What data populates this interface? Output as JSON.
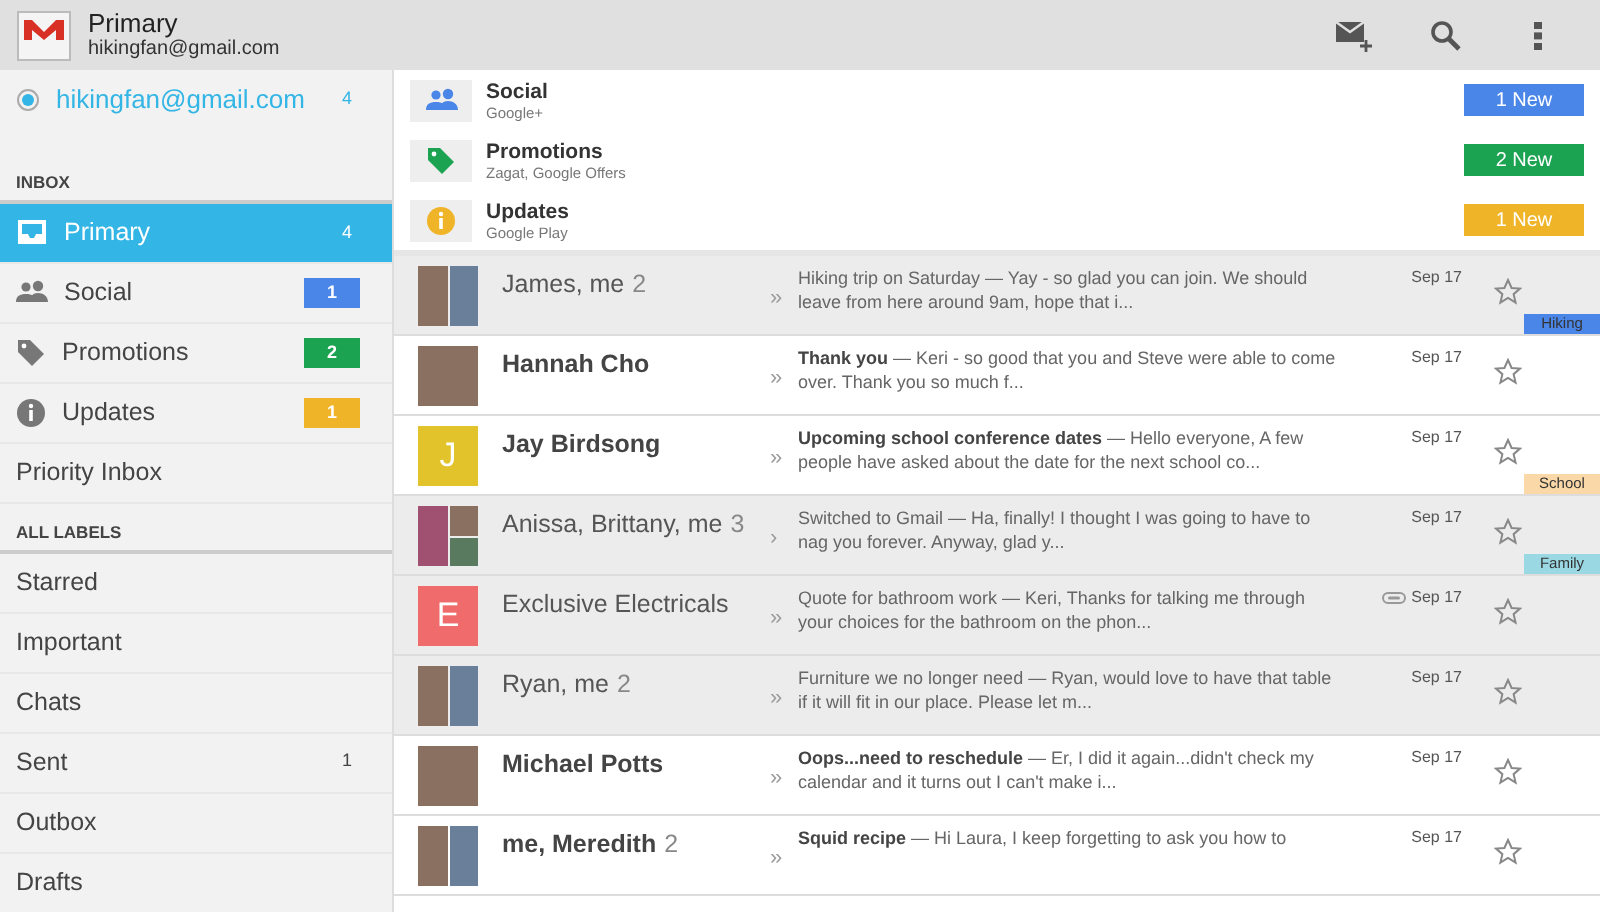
{
  "header": {
    "title": "Primary",
    "account": "hikingfan@gmail.com"
  },
  "sidebar": {
    "items": [
      {
        "kind": "account",
        "label": "hikingfan@gmail.com",
        "count": "4",
        "selected": true
      },
      {
        "kind": "header",
        "label": "INBOX"
      },
      {
        "kind": "inbox",
        "label": "Primary",
        "count": "4",
        "selected": true
      },
      {
        "kind": "people",
        "label": "Social",
        "count": "1",
        "color": "#4a86e8",
        "selected": false
      },
      {
        "kind": "tag",
        "label": "Promotions",
        "count": "2",
        "color": "#1ca352",
        "selected": false
      },
      {
        "kind": "info",
        "label": "Updates",
        "count": "1",
        "color": "#f0b429",
        "selected": false
      },
      {
        "kind": "item",
        "label": "Priority Inbox",
        "selected": false
      },
      {
        "kind": "header",
        "label": "ALL LABELS"
      },
      {
        "kind": "item",
        "label": "Starred",
        "selected": false
      },
      {
        "kind": "item",
        "label": "Important",
        "selected": false
      },
      {
        "kind": "item",
        "label": "Chats",
        "selected": false
      },
      {
        "kind": "item",
        "label": "Sent",
        "count": "1",
        "selected": false
      },
      {
        "kind": "item",
        "label": "Outbox",
        "selected": false
      },
      {
        "kind": "item",
        "label": "Drafts",
        "selected": false
      }
    ]
  },
  "categories": [
    {
      "kind": "people",
      "title": "Social",
      "subtitle": "Google+",
      "badge": "1 New",
      "color": "#4a86e8"
    },
    {
      "kind": "tag",
      "title": "Promotions",
      "subtitle": "Zagat, Google Offers",
      "badge": "2 New",
      "color": "#1ca352"
    },
    {
      "kind": "info",
      "title": "Updates",
      "subtitle": "Google Play",
      "badge": "1 New",
      "color": "#f0b429"
    }
  ],
  "messages": [
    {
      "avatar": {
        "kind": "photo-pair"
      },
      "sender": "James, me",
      "count": "2",
      "unread": false,
      "marker": "»",
      "preview": "Hiking trip on Saturday — Yay - so glad you can join. We should leave from here around 9am, hope that i...",
      "date": "Sep 17",
      "attachment": false,
      "starred": false,
      "label": {
        "text": "Hiking",
        "color": "#4a86e8"
      }
    },
    {
      "avatar": {
        "kind": "photo"
      },
      "sender": "Hannah Cho",
      "unread": true,
      "marker": "»",
      "preview": "**Thank you** — Keri - so good that you and Steve were able to come over. Thank you so much f...",
      "date": "Sep 17",
      "attachment": false,
      "starred": false
    },
    {
      "avatar": {
        "kind": "letter",
        "letter": "J",
        "color": "#e2c32b"
      },
      "sender": "Jay Birdsong",
      "unread": true,
      "marker": "»",
      "preview": "**Upcoming school conference dates** — Hello everyone, A few people have asked about the date for the next school co...",
      "date": "Sep 17",
      "attachment": false,
      "starred": false,
      "label": {
        "text": "School",
        "color": "#fbd8a8"
      }
    },
    {
      "avatar": {
        "kind": "photo-trio"
      },
      "sender": "Anissa, Brittany, me",
      "count": "3",
      "unread": false,
      "marker": "›",
      "preview": "Switched to Gmail — Ha, finally! I thought I was going to have to nag you forever. Anyway, glad y...",
      "date": "Sep 17",
      "attachment": false,
      "starred": false,
      "label": {
        "text": "Family",
        "color": "#9ad8e4"
      }
    },
    {
      "avatar": {
        "kind": "letter",
        "letter": "E",
        "color": "#f06c6c"
      },
      "sender": "Exclusive Electricals",
      "unread": false,
      "marker": "»",
      "preview": "Quote for bathroom work — Keri, Thanks for talking me through your choices for the bathroom on the phon...",
      "date": "Sep 17",
      "attachment": true,
      "starred": false
    },
    {
      "avatar": {
        "kind": "photo-pair"
      },
      "sender": "Ryan, me",
      "count": "2",
      "unread": false,
      "marker": "»",
      "preview": "Furniture we no longer need — Ryan, would love to have that table if it will fit in our place. Please let m...",
      "date": "Sep 17",
      "attachment": false,
      "starred": false
    },
    {
      "avatar": {
        "kind": "photo"
      },
      "sender": "Michael Potts",
      "unread": true,
      "marker": "»",
      "preview": "**Oops...need to reschedule** — Er, I did it again...didn't check my calendar and it turns out I can't make i...",
      "date": "Sep 17",
      "attachment": false,
      "starred": false
    },
    {
      "avatar": {
        "kind": "photo-pair"
      },
      "sender": "me, Meredith",
      "count": "2",
      "unread": true,
      "marker": "»",
      "preview": "**Squid recipe** — Hi Laura, I keep forgetting to ask you how to",
      "date": "Sep 17",
      "attachment": false,
      "starred": false
    }
  ]
}
